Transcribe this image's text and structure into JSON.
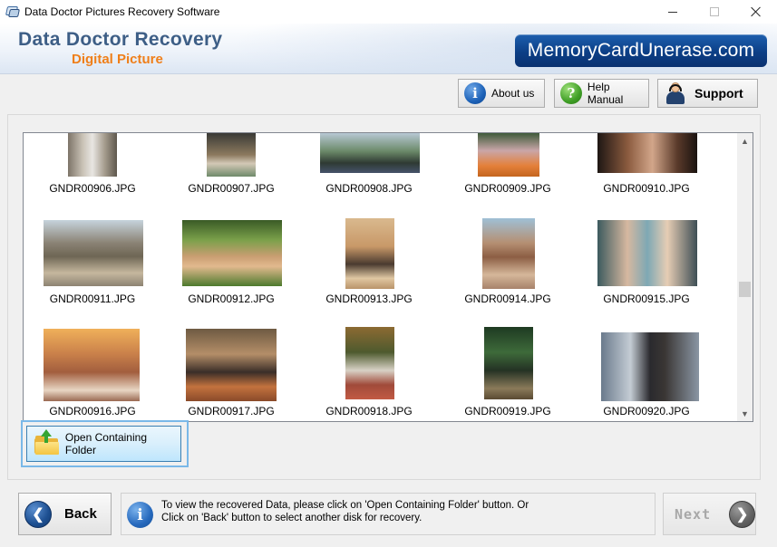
{
  "window": {
    "title": "Data Doctor Pictures Recovery Software"
  },
  "banner": {
    "brand_main": "Data Doctor Recovery",
    "brand_sub": "Digital Picture",
    "site": "MemoryCardUnerase.com",
    "colors": {
      "brand_main": "#3d5e86",
      "brand_sub": "#ef7f1a",
      "site_badge": "#0c3f86"
    }
  },
  "toolbar": {
    "about_label": "About us",
    "help_label": "Help Manual",
    "support_label": "Support"
  },
  "gallery": {
    "files": [
      "GNDR00906.JPG",
      "GNDR00907.JPG",
      "GNDR00908.JPG",
      "GNDR00909.JPG",
      "GNDR00910.JPG",
      "GNDR00911.JPG",
      "GNDR00912.JPG",
      "GNDR00913.JPG",
      "GNDR00914.JPG",
      "GNDR00915.JPG",
      "GNDR00916.JPG",
      "GNDR00917.JPG",
      "GNDR00918.JPG",
      "GNDR00919.JPG",
      "GNDR00920.JPG"
    ]
  },
  "actions": {
    "open_folder_label": "Open Containing Folder"
  },
  "footer": {
    "back_label": "Back",
    "next_label": "Next",
    "info_line1": "To view the recovered Data, please click on 'Open Containing Folder' button. Or",
    "info_line2": "Click on 'Back' button to select another disk for recovery."
  }
}
